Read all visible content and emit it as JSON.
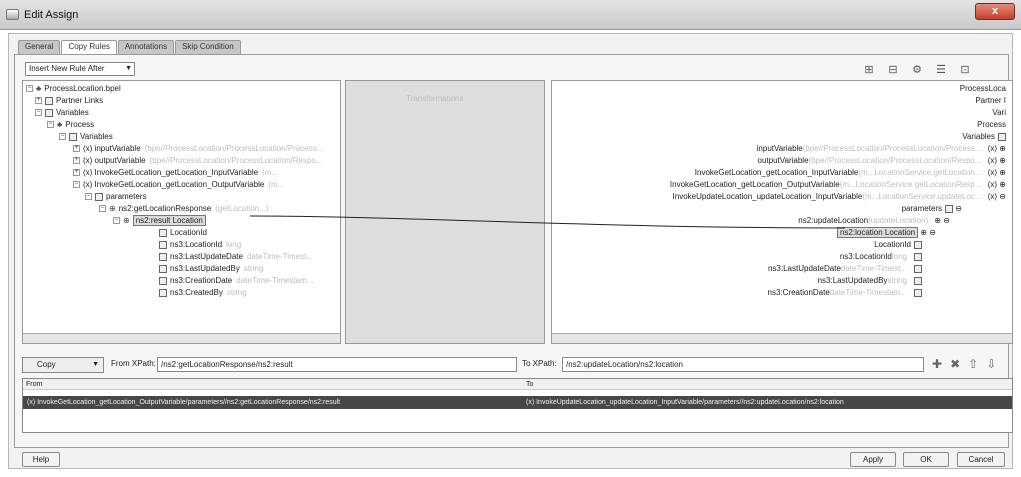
{
  "window": {
    "title": "Edit Assign",
    "close_label": "x"
  },
  "tabs": [
    "General",
    "Copy Rules",
    "Annotations",
    "Skip Condition"
  ],
  "rule_select": {
    "value": "Insert New Rule After"
  },
  "left_tree": [
    {
      "label": "ProcessLocation.bpel",
      "hint": ""
    },
    {
      "label": "Partner Links",
      "hint": ""
    },
    {
      "label": "Variables",
      "hint": ""
    },
    {
      "label": "Process",
      "hint": ""
    },
    {
      "label": "Variables",
      "hint": ""
    },
    {
      "label": "(x) inputVariable",
      "hint": "(bpe//ProcessLocation/ProcessLocation/Process..."
    },
    {
      "label": "(x) outputVariable",
      "hint": "(bpe//ProcessLocation/ProcessLocation/Respo..."
    },
    {
      "label": "(x) InvokeGetLocation_getLocation_InputVariable",
      "hint": "(m..."
    },
    {
      "label": "(x) InvokeGetLocation_getLocation_OutputVariable",
      "hint": "(m..."
    },
    {
      "label": "parameters",
      "hint": ""
    },
    {
      "label": "ns2:getLocationResponse",
      "hint": "(getLocation...)"
    },
    {
      "label": "ns2:result Location",
      "hint": ""
    },
    {
      "label": "LocationId",
      "hint": ""
    },
    {
      "label": "ns3:LocationId",
      "hint": "long"
    },
    {
      "label": "ns3:LastUpdateDate",
      "hint": "dateTime-Timest..."
    },
    {
      "label": "ns3:LastUpdatedBy",
      "hint": "string"
    },
    {
      "label": "ns3:CreationDate",
      "hint": "dateTime-Timestam..."
    },
    {
      "label": "ns3:CreatedBy",
      "hint": "string"
    }
  ],
  "right_tree": [
    {
      "label": "ProcessLoca",
      "hint": ""
    },
    {
      "label": "Partner I",
      "hint": ""
    },
    {
      "label": "Vari",
      "hint": ""
    },
    {
      "label": "Process",
      "hint": ""
    },
    {
      "label": "Variables",
      "hint": ""
    },
    {
      "label": "inputVariable",
      "hint": "(bpe//ProcessLocation/ProcessLocation/Process..."
    },
    {
      "label": "outputVariable",
      "hint": "(bpe//ProcessLocation/ProcessLocation/Respo..."
    },
    {
      "label": "InvokeGetLocation_getLocation_InputVariable",
      "hint": "(m...LocationService.getLocation..."
    },
    {
      "label": "InvokeGetLocation_getLocation_OutputVariable",
      "hint": "(m...LocationService.getLocationResp..."
    },
    {
      "label": "InvokeUpdateLocation_updateLocation_InputVariable",
      "hint": "(m...LocationService.updateLoc..."
    },
    {
      "label": "parameters",
      "hint": ""
    },
    {
      "label": "ns2:updateLocation",
      "hint": "(updateLocation)"
    },
    {
      "label": "ns2:location Location",
      "hint": ""
    },
    {
      "label": "LocationId",
      "hint": ""
    },
    {
      "label": "ns3:LocationId",
      "hint": "long"
    },
    {
      "label": "ns3:LastUpdateDate",
      "hint": "dateTime-Timest..."
    },
    {
      "label": "ns3:LastUpdatedBy",
      "hint": "string"
    },
    {
      "label": "ns3:CreationDate",
      "hint": "dateTime-Timestam..."
    }
  ],
  "mid_panel": {
    "caption": "Transformations"
  },
  "copy_bar": {
    "copy_label": "Copy",
    "from_label": "From XPath:",
    "from_value": "/ns2:getLocationResponse/ns2:result",
    "to_label": "To XPath:",
    "to_value": "/ns2:updateLocation/ns2:location"
  },
  "grid": {
    "from_header": "From",
    "to_header": "To",
    "from_value": "(x) InvokeGetLocation_getLocation_OutputVariable/parameters//ns2:getLocationResponse/ns2:result",
    "to_value": "(x) InvokeUpdateLocation_updateLocation_InputVariable/parameters//ns2:updateLocation/ns2:location"
  },
  "buttons": {
    "help": "Help",
    "apply": "Apply",
    "ok": "OK",
    "cancel": "Cancel"
  }
}
